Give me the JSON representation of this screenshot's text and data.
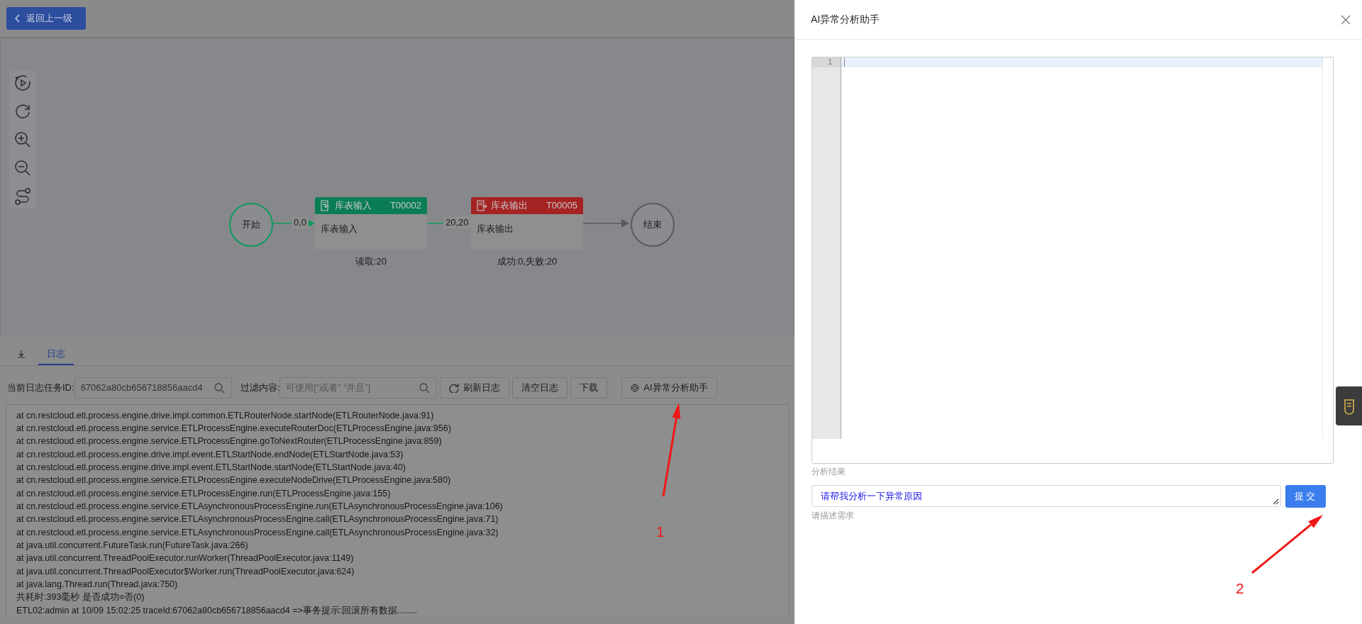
{
  "back_button": {
    "label": "返回上一级"
  },
  "flow": {
    "start": {
      "label": "开始"
    },
    "end": {
      "label": "结束"
    },
    "nodes": [
      {
        "title": "库表输入",
        "code": "T00002",
        "body": "库表输入",
        "stats": "读取:20",
        "color": "#0b7d55",
        "kind": "input"
      },
      {
        "title": "库表输出",
        "code": "T00005",
        "body": "库表输出",
        "stats": "成功:0,失败:20",
        "color": "#a52323",
        "kind": "output"
      }
    ],
    "edges": [
      {
        "label": "0,0"
      },
      {
        "label": "20,20"
      }
    ]
  },
  "bottom_tabs": [
    {
      "kind": "download",
      "selected": false
    },
    {
      "kind": "text",
      "label": "日志",
      "selected": true
    }
  ],
  "log_toolbar": {
    "task_id_label": "当前日志任务ID:",
    "task_id_value": "67062a80cb656718856aacd4",
    "filter_label": "过滤内容:",
    "filter_placeholder": "可使用[“或者” “并且”]",
    "buttons": [
      {
        "label": "刷新日志",
        "kind": "refresh"
      },
      {
        "label": "清空日志",
        "kind": "plain"
      },
      {
        "label": "下载",
        "kind": "plain"
      },
      {
        "label": "AI异常分析助手",
        "kind": "ai"
      }
    ]
  },
  "log_lines": [
    "at cn.restcloud.etl.process.engine.drive.impl.common.ETLRouterNode.startNode(ETLRouterNode.java:91)",
    "at cn.restcloud.etl.process.engine.service.ETLProcessEngine.executeRouterDoc(ETLProcessEngine.java:956)",
    "at cn.restcloud.etl.process.engine.service.ETLProcessEngine.goToNextRouter(ETLProcessEngine.java:859)",
    "at cn.restcloud.etl.process.engine.drive.impl.event.ETLStartNode.endNode(ETLStartNode.java:53)",
    "at cn.restcloud.etl.process.engine.drive.impl.event.ETLStartNode.startNode(ETLStartNode.java:40)",
    "at cn.restcloud.etl.process.engine.service.ETLProcessEngine.executeNodeDrive(ETLProcessEngine.java:580)",
    "at cn.restcloud.etl.process.engine.service.ETLProcessEngine.run(ETLProcessEngine.java:155)",
    "at cn.restcloud.etl.process.engine.service.ETLAsynchronousProcessEngine.run(ETLAsynchronousProcessEngine.java:106)",
    "at cn.restcloud.etl.process.engine.service.ETLAsynchronousProcessEngine.call(ETLAsynchronousProcessEngine.java:71)",
    "at cn.restcloud.etl.process.engine.service.ETLAsynchronousProcessEngine.call(ETLAsynchronousProcessEngine.java:32)",
    "at java.util.concurrent.FutureTask.run(FutureTask.java:266)",
    "at java.util.concurrent.ThreadPoolExecutor.runWorker(ThreadPoolExecutor.java:1149)",
    "at java.util.concurrent.ThreadPoolExecutor$Worker.run(ThreadPoolExecutor.java:624)",
    "at java.lang.Thread.run(Thread.java:750)",
    "共耗时:393毫秒 是否成功=否(0)",
    "ETL02:admin at 10/09 15:02:25 traceId:67062a80cb656718856aacd4 =>事务提示:回滚所有数据........"
  ],
  "drawer": {
    "title": "AI异常分析助手",
    "editor": {
      "lines": [
        {
          "number": "1",
          "active": true
        }
      ]
    },
    "result_label": "分析结果",
    "prompt": {
      "value": "请帮我分析一下异常原因"
    },
    "prompt_hint": "请描述需求",
    "submit": "提交"
  },
  "annotations": [
    {
      "label": "1",
      "kind": "up"
    },
    {
      "label": "2",
      "kind": "up-right"
    }
  ]
}
